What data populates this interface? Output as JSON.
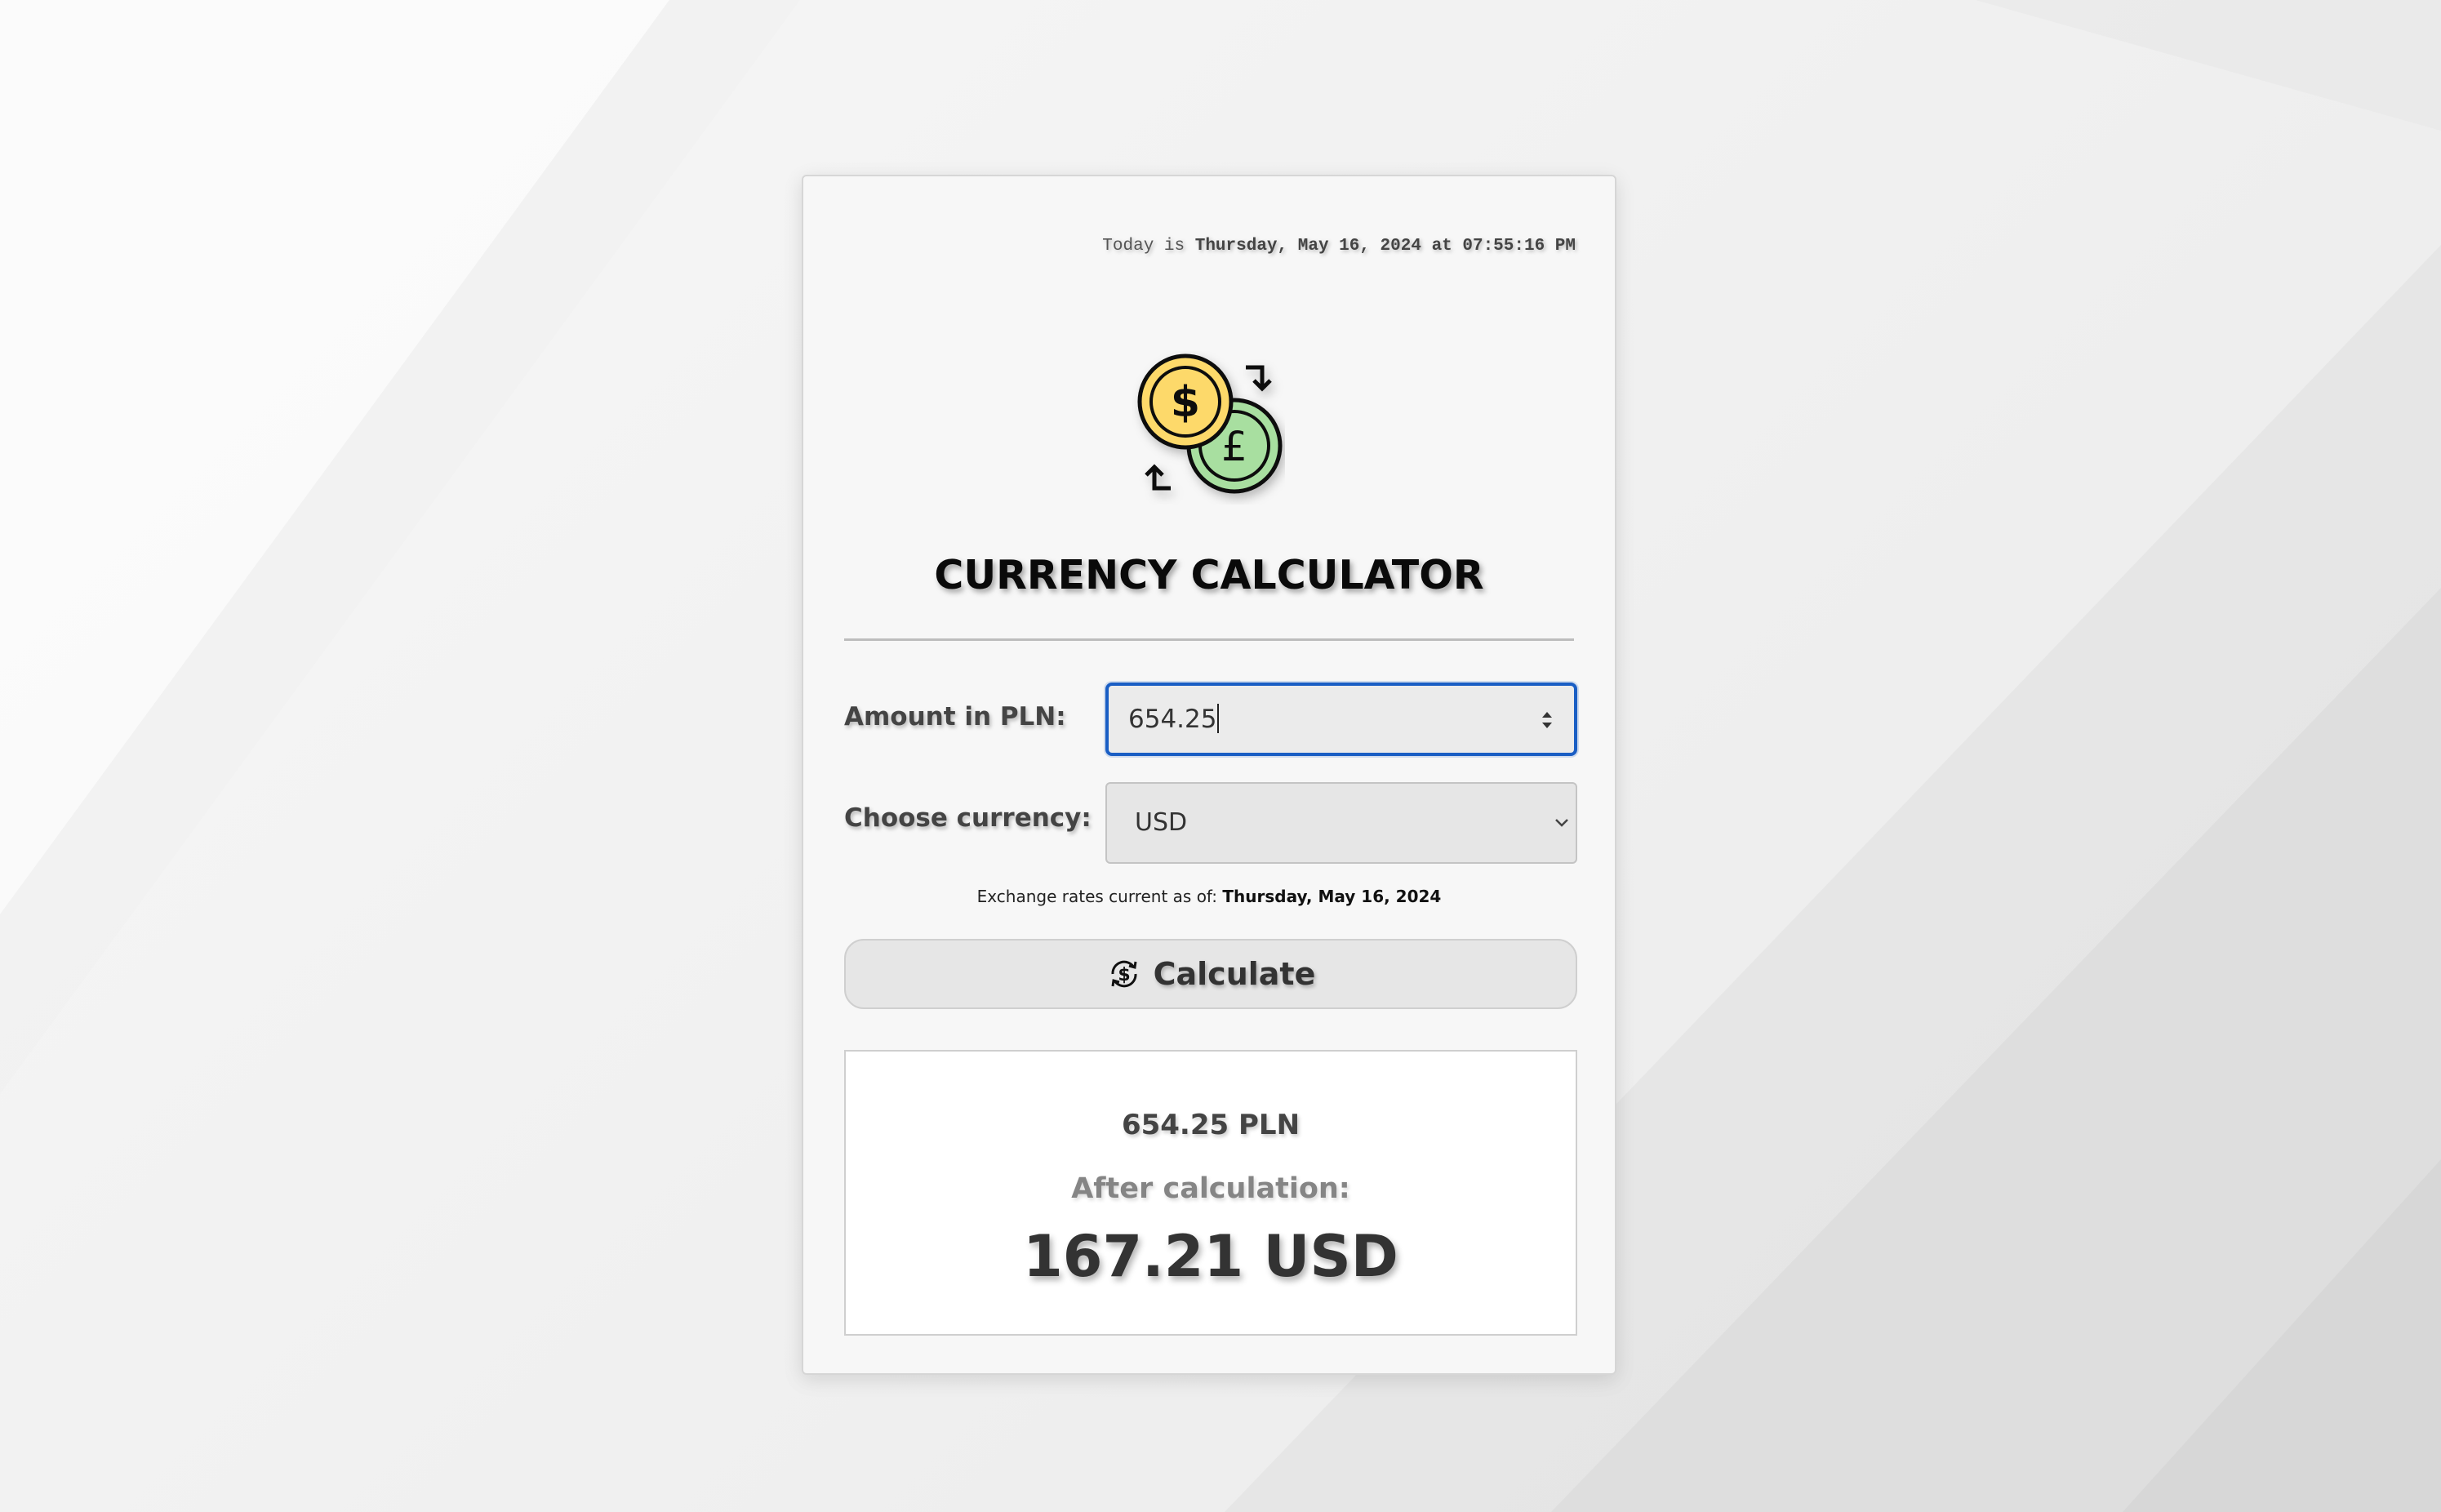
{
  "header": {
    "date_prefix": "Today is",
    "date_value": "Thursday, May 16, 2024 at 07:55:16 PM"
  },
  "logo": {
    "icon": "currency-exchange-icon",
    "colors": {
      "dollar_coin": "#fdd96a",
      "pound_coin": "#a8dfa0",
      "outline": "#111111"
    }
  },
  "title": "CURRENCY CALCULATOR",
  "form": {
    "amount_label": "Amount in PLN:",
    "amount_value": "654.25",
    "currency_label": "Choose currency:",
    "currency_selected": "USD"
  },
  "rates_note": {
    "prefix": "Exchange rates current as of:",
    "date": "Thursday, May 16, 2024"
  },
  "calculate_button": {
    "label": "Calculate",
    "icon": "currency-refresh-icon"
  },
  "result": {
    "input_amount": "654.25 PLN",
    "after_label": "After calculation:",
    "output_amount": "167.21 USD"
  },
  "colors": {
    "input_focus_border": "#1a5ec4",
    "background": "#f4f4f4",
    "card": "#f7f7f7"
  }
}
